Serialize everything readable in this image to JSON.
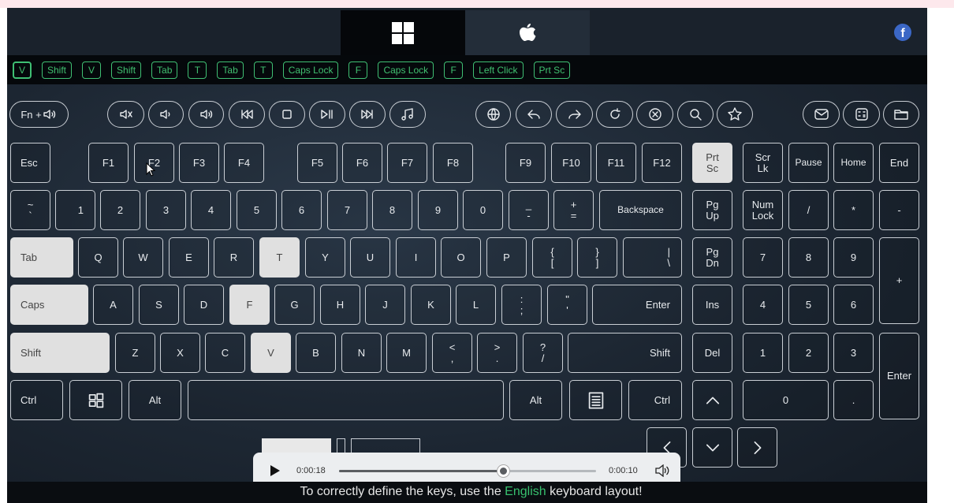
{
  "os_tabs": [
    {
      "name": "windows-icon",
      "active": true
    },
    {
      "name": "apple-icon",
      "active": false
    }
  ],
  "social": {
    "facebook_label": "f"
  },
  "combo_chips": [
    {
      "label": "V",
      "highlighted": true
    },
    {
      "label": "Shift",
      "highlighted": false
    },
    {
      "label": "V",
      "highlighted": false
    },
    {
      "label": "Shift",
      "highlighted": false
    },
    {
      "label": "Tab",
      "highlighted": false
    },
    {
      "label": "T",
      "highlighted": false
    },
    {
      "label": "Tab",
      "highlighted": false
    },
    {
      "label": "T",
      "highlighted": false
    },
    {
      "label": "Caps Lock",
      "highlighted": false
    },
    {
      "label": "F",
      "highlighted": false
    },
    {
      "label": "Caps Lock",
      "highlighted": false
    },
    {
      "label": "F",
      "highlighted": false
    },
    {
      "label": "Left Click",
      "highlighted": false
    },
    {
      "label": "Prt Sc",
      "highlighted": false
    }
  ],
  "media_keys": {
    "fn_label": "Fn +",
    "icons": [
      "mute-icon",
      "volume-down-icon",
      "volume-up-icon",
      "previous-track-icon",
      "stop-icon",
      "play-pause-icon",
      "next-track-icon",
      "music-icon",
      "browser-icon",
      "back-icon",
      "forward-icon",
      "refresh-icon",
      "close-icon",
      "search-icon",
      "favorites-icon",
      "mail-icon",
      "calculator-icon",
      "folder-icon"
    ]
  },
  "keys": {
    "esc": "Esc",
    "f1": "F1",
    "f2": "F2",
    "f3": "F3",
    "f4": "F4",
    "f5": "F5",
    "f6": "F6",
    "f7": "F7",
    "f8": "F8",
    "f9": "F9",
    "f10": "F10",
    "f11": "F11",
    "f12": "F12",
    "prtsc_1": "Prt",
    "prtsc_2": "Sc",
    "scrlk_1": "Scr",
    "scrlk_2": "Lk",
    "pause": "Pause",
    "home": "Home",
    "end": "End",
    "tilde_1": "~",
    "tilde_2": "`",
    "d1": "1",
    "d2": "2",
    "d3": "3",
    "d4": "4",
    "d5": "5",
    "d6": "6",
    "d7": "7",
    "d8": "8",
    "d9": "9",
    "d0": "0",
    "minus_1": "_",
    "minus_2": "-",
    "plus_1": "+",
    "plus_2": "=",
    "backspace": "Backspace",
    "pgup_1": "Pg",
    "pgup_2": "Up",
    "numlock_1": "Num",
    "numlock_2": "Lock",
    "np_div": "/",
    "np_mul": "*",
    "np_minus": "-",
    "tab": "Tab",
    "q": "Q",
    "w": "W",
    "e": "E",
    "r": "R",
    "t": "T",
    "y": "Y",
    "u": "U",
    "i": "I",
    "o": "O",
    "p": "P",
    "lbrace_1": "{",
    "lbrace_2": "[",
    "rbrace_1": "}",
    "rbrace_2": "]",
    "pipe_1": "|",
    "pipe_2": "\\",
    "pgdn_1": "Pg",
    "pgdn_2": "Dn",
    "np7": "7",
    "np8": "8",
    "np9": "9",
    "np_plus": "+",
    "caps": "Caps",
    "a": "A",
    "s": "S",
    "d": "D",
    "f": "F",
    "g": "G",
    "h": "H",
    "j": "J",
    "k": "K",
    "l": "L",
    "colon_1": ":",
    "colon_2": ";",
    "quote_1": "\"",
    "quote_2": "'",
    "enter": "Enter",
    "ins": "Ins",
    "np4": "4",
    "np5": "5",
    "np6": "6",
    "shift_l": "Shift",
    "z": "Z",
    "x": "X",
    "c": "C",
    "v": "V",
    "b": "B",
    "n": "N",
    "m": "M",
    "lt_1": "<",
    "lt_2": ",",
    "gt_1": ">",
    "gt_2": ".",
    "q_1": "?",
    "q_2": "/",
    "shift_r": "Shift",
    "del": "Del",
    "np1": "1",
    "np2": "2",
    "np3": "3",
    "np_enter": "Enter",
    "ctrl_l": "Ctrl",
    "alt_l": "Alt",
    "alt_r": "Alt",
    "ctrl_r": "Ctrl",
    "np0": "0",
    "np_dot": "."
  },
  "lit_keys": [
    "prtsc",
    "tab",
    "t",
    "caps",
    "f",
    "shift_l",
    "v"
  ],
  "player": {
    "elapsed": "0:00:18",
    "remaining": "0:00:10",
    "progress": 0.64
  },
  "caption": {
    "before": "To correctly define the keys, use the ",
    "highlight": "English",
    "after": " keyboard layout!"
  },
  "colors": {
    "accent_green": "#3fbf73",
    "key_lit": "#e0e0e0",
    "facebook_blue": "#3b67c6"
  }
}
